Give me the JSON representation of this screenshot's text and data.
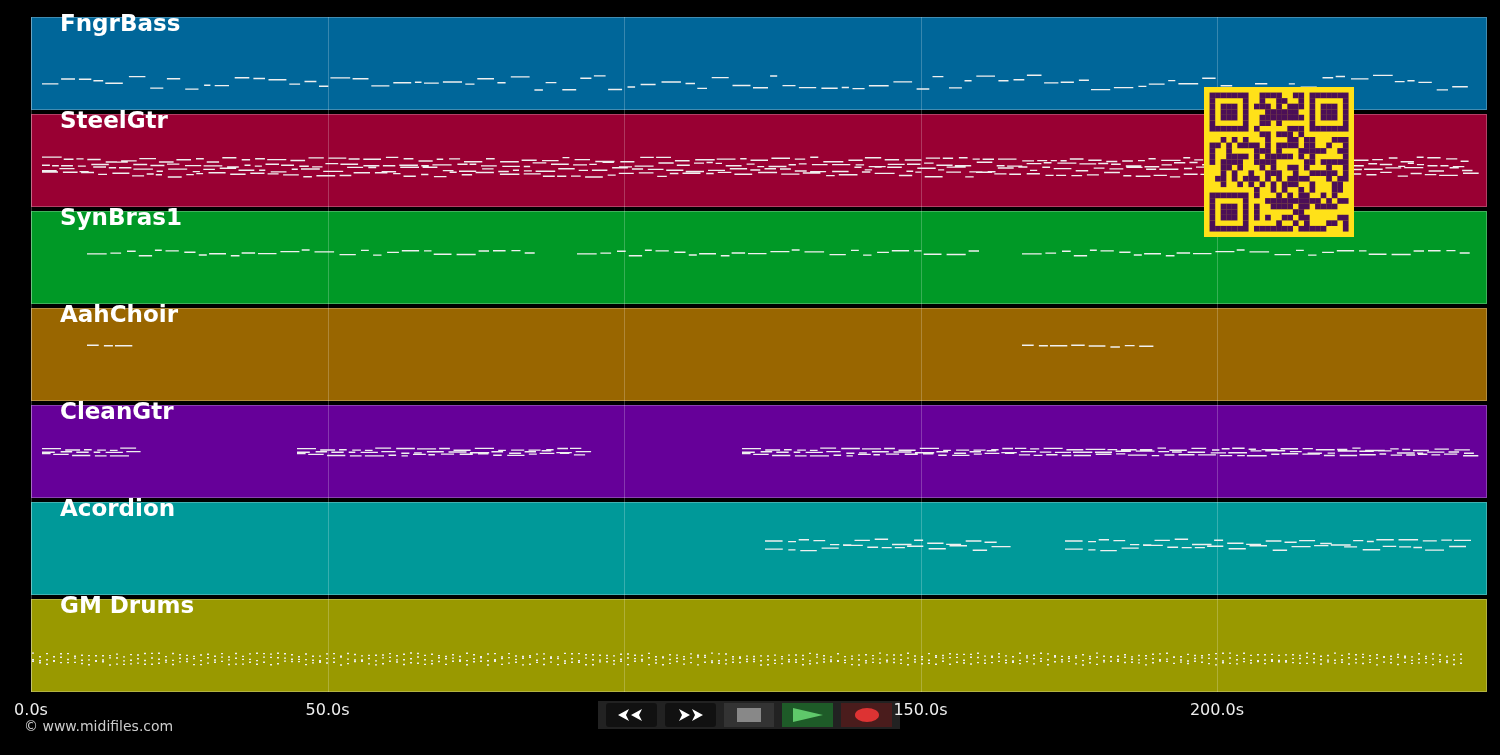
{
  "tracks": [
    {
      "name": "FngrBass",
      "color": "#006699"
    },
    {
      "name": "SteelGtr",
      "color": "#990033"
    },
    {
      "name": "SynBras1",
      "color": "#009926"
    },
    {
      "name": "AahChoir",
      "color": "#996600"
    },
    {
      "name": "CleanGtr",
      "color": "#660099"
    },
    {
      "name": "Acordion",
      "color": "#009999"
    },
    {
      "name": "GM Drums",
      "color": "#999900"
    }
  ],
  "time_axis": {
    "ticks": [
      "0.0s",
      "50.0s",
      "150.0s",
      "200.0s"
    ]
  },
  "transport": [
    {
      "kind": "rewind"
    },
    {
      "kind": "forward"
    },
    {
      "kind": "stop"
    },
    {
      "kind": "play"
    },
    {
      "kind": "record"
    }
  ],
  "copyright": "© www.midifiles.com"
}
